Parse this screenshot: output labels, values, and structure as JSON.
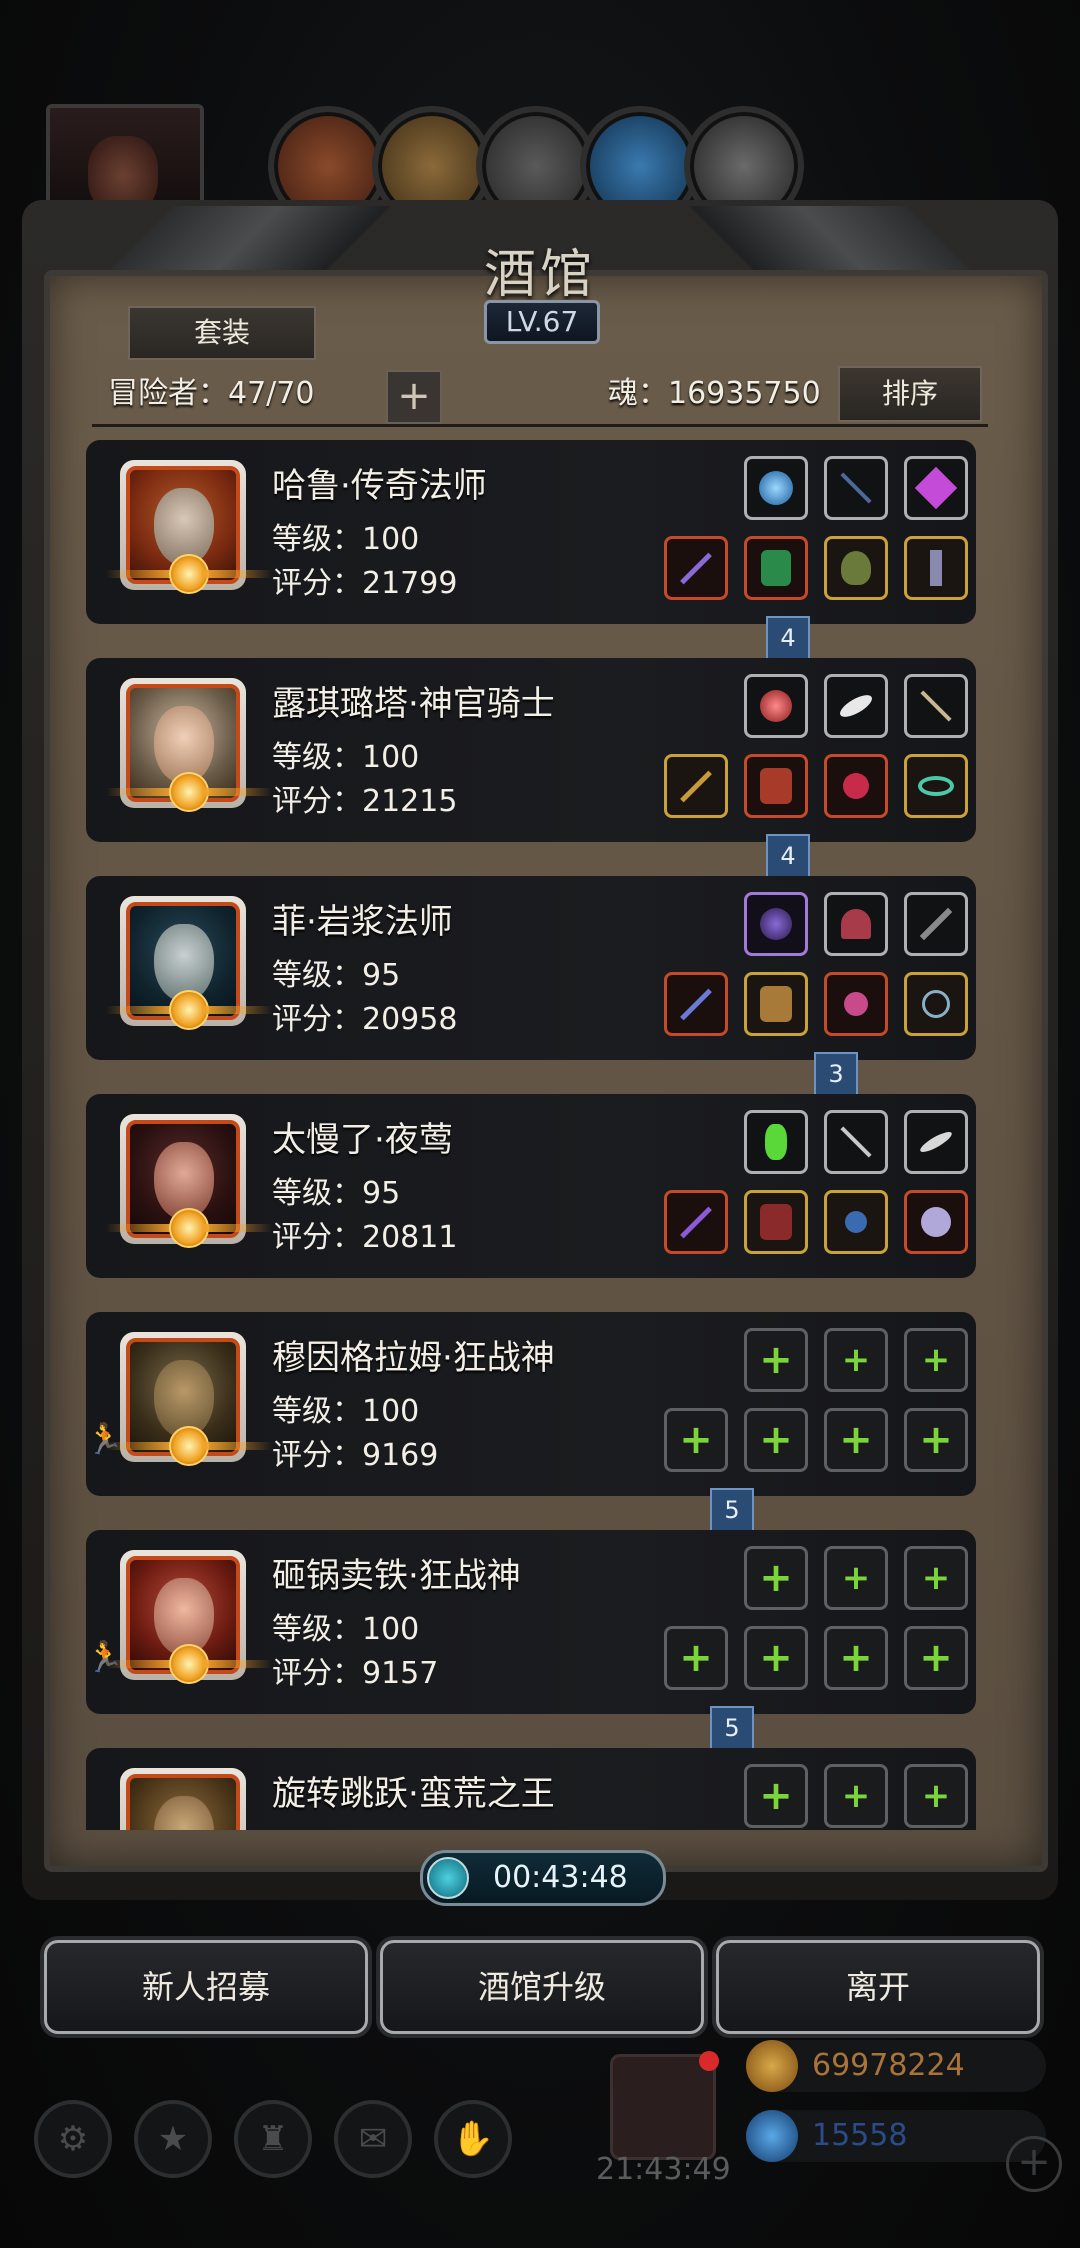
{
  "header": {
    "title": "酒馆",
    "level": "LV.67",
    "set_button": "套装",
    "adventurers_label": "冒险者：47/70",
    "add_symbol": "+",
    "soul_label": "魂：16935750",
    "sort_button": "排序"
  },
  "heroes": [
    {
      "name": "哈鲁·传奇法师",
      "level": "等级：100",
      "score": "评分：21799",
      "ribbon": "4"
    },
    {
      "name": "露琪璐塔·神官骑士",
      "level": "等级：100",
      "score": "评分：21215",
      "ribbon": "4"
    },
    {
      "name": "菲·岩浆法师",
      "level": "等级：95",
      "score": "评分：20958",
      "ribbon": "3"
    },
    {
      "name": "太慢了·夜莺",
      "level": "等级：95",
      "score": "评分：20811",
      "ribbon": ""
    },
    {
      "name": "穆因格拉姆·狂战神",
      "level": "等级：100",
      "score": "评分：9169",
      "ribbon": "5"
    },
    {
      "name": "砸锅卖铁·狂战神",
      "level": "等级：100",
      "score": "评分：9157",
      "ribbon": "5"
    },
    {
      "name": "旋转跳跃·蛮荒之王",
      "level": "",
      "score": "",
      "ribbon": ""
    }
  ],
  "timer": "00:43:48",
  "buttons": {
    "recruit": "新人招募",
    "upgrade": "酒馆升级",
    "leave": "离开"
  },
  "footer": {
    "gift_time": "21:43:49",
    "gold": "69978224",
    "gems": "15558",
    "gold_color": "#a8743a",
    "gem_color": "#2a4c8a"
  }
}
